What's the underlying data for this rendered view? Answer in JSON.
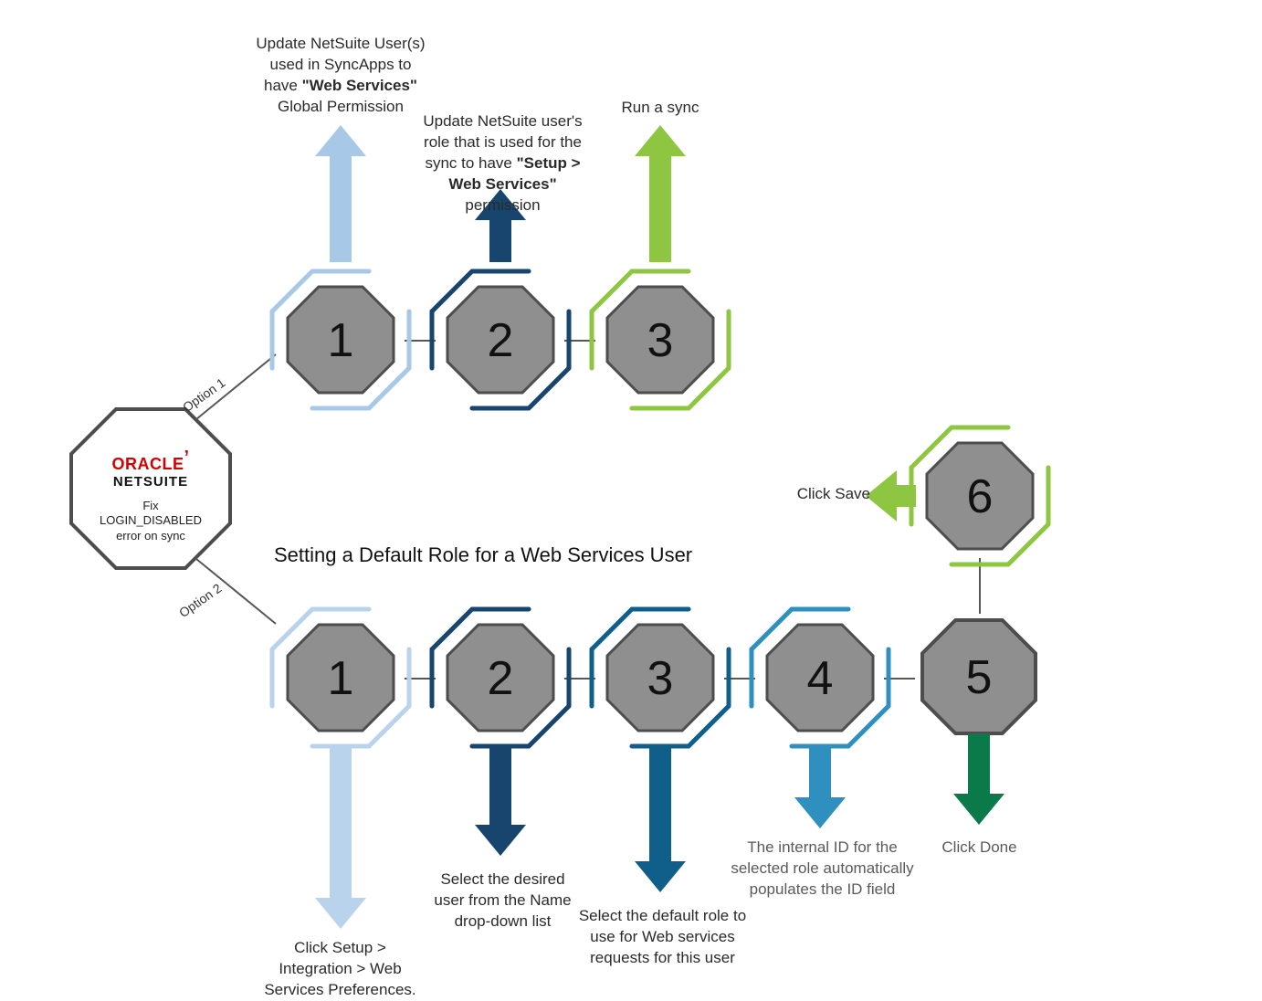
{
  "brand": {
    "line1": "ORACLE",
    "line2": "NETSUITE",
    "sub": "Fix LOGIN_DISABLED error on sync"
  },
  "labels": {
    "option1": "Option 1",
    "option2": "Option 2"
  },
  "section_title": "Setting a Default Role for a Web Services User",
  "opt1": {
    "s1": {
      "num": "1",
      "text_pre": "Update NetSuite User(s) used in SyncApps to have ",
      "text_bold": "\"Web Services\"",
      "text_post": " Global Permission"
    },
    "s2": {
      "num": "2",
      "text_pre": "Update NetSuite user's role that is used for the sync to have ",
      "text_bold": "\"Setup > Web Services\"",
      "text_post": " permission"
    },
    "s3": {
      "num": "3",
      "text": "Run a sync"
    }
  },
  "opt2": {
    "s1": {
      "num": "1",
      "text": "Click Setup > Integration > Web Services Preferences."
    },
    "s2": {
      "num": "2",
      "text": "Select the desired user from the Name drop-down list"
    },
    "s3": {
      "num": "3",
      "text": "Select the default role to use for Web services requests for this user"
    },
    "s4": {
      "num": "4",
      "text": "The internal ID for the selected role automatically populates the ID field"
    },
    "s5": {
      "num": "5",
      "text": "Click Done"
    },
    "s6": {
      "num": "6",
      "text": "Click Save"
    }
  },
  "colors": {
    "o1s1": "#a8c8e8",
    "o1s2": "#17456e",
    "o1s3": "#8ec641",
    "o2s1": "#b9d3ec",
    "o2s2": "#17456e",
    "o2s3": "#0f5f8a",
    "o2s4": "#2f8fbf",
    "o2s5": "#0a7a4a",
    "o2s6": "#8ec641",
    "nodeFill": "#8f8f8f",
    "nodeStroke": "#4d4d4d"
  }
}
